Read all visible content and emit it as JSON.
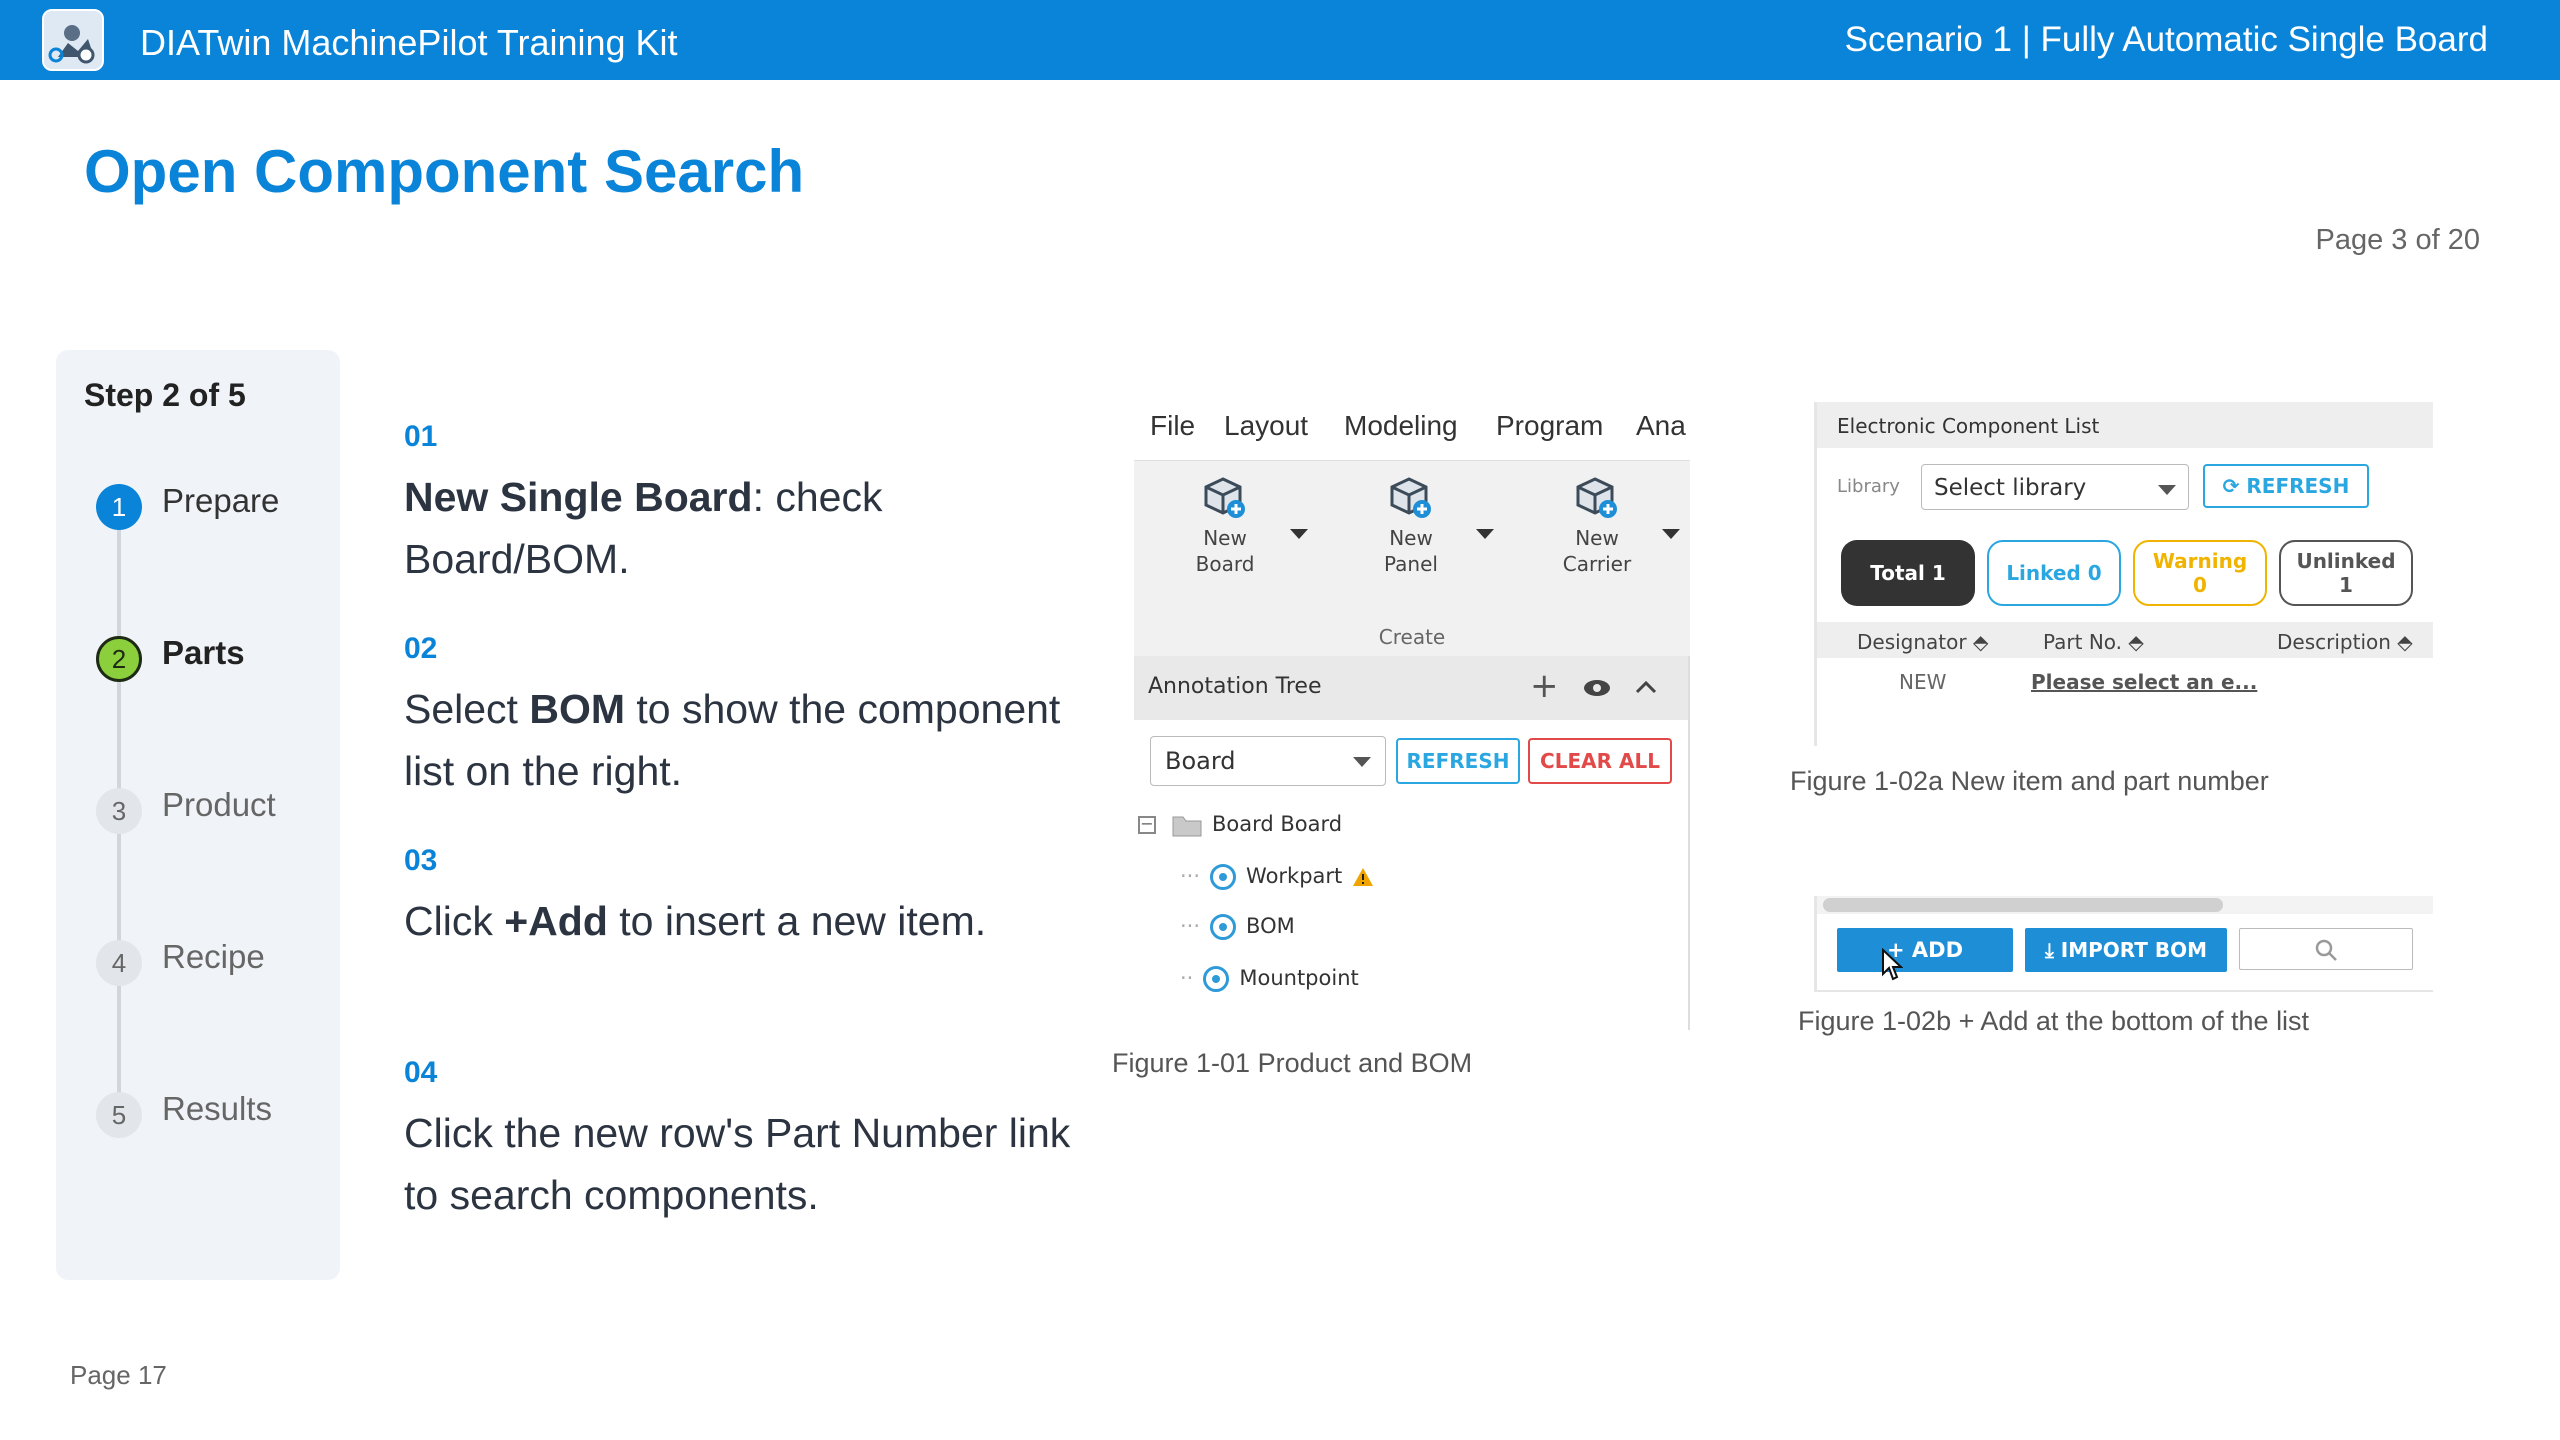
{
  "header": {
    "app_title": "DIATwin MachinePilot Training Kit",
    "scenario": "Scenario 1 | Fully Automatic Single Board",
    "accent_color": "#0a84d8"
  },
  "page": {
    "title": "Open Component Search",
    "page_of": "Page 3 of 20",
    "footer_page": "Page 17"
  },
  "steps": {
    "heading": "Step 2 of 5",
    "items": [
      {
        "num": "1",
        "label": "Prepare",
        "state": "done"
      },
      {
        "num": "2",
        "label": "Parts",
        "state": "current"
      },
      {
        "num": "3",
        "label": "Product",
        "state": "pending"
      },
      {
        "num": "4",
        "label": "Recipe",
        "state": "pending"
      },
      {
        "num": "5",
        "label": "Results",
        "state": "pending"
      }
    ]
  },
  "instructions": [
    {
      "num": "01",
      "bold": "New Single Board",
      "rest": ": check Board/BOM."
    },
    {
      "num": "02",
      "pre": "Select ",
      "bold": "BOM",
      "rest": " to show the component list on the right."
    },
    {
      "num": "03",
      "pre": "Click ",
      "bold": "+Add",
      "rest": " to insert a new item."
    },
    {
      "num": "04",
      "text": "Click the new row's Part Number link to search components."
    }
  ],
  "fig1": {
    "menu": [
      "File",
      "Layout",
      "Modeling",
      "Program",
      "Ana"
    ],
    "ribbon_buttons": [
      {
        "line1": "New",
        "line2": "Board",
        "icon": "cube-add-icon"
      },
      {
        "line1": "New",
        "line2": "Panel",
        "icon": "cube-add-icon"
      },
      {
        "line1": "New",
        "line2": "Carrier",
        "icon": "cube-add-icon"
      }
    ],
    "ribbon_group": "Create",
    "annotation_tree_title": "Annotation Tree",
    "select_value": "Board",
    "refresh_label": "REFRESH",
    "clear_all_label": "CLEAR ALL",
    "tree_root": "Board  Board",
    "tree_items": [
      "Workpart",
      "BOM",
      "Mountpoint"
    ],
    "caption": "Figure 1-01  Product and BOM"
  },
  "fig2a": {
    "title": "Electronic Component List",
    "library_label": "Library",
    "library_select": "Select library",
    "refresh_label": "REFRESH",
    "pills": [
      {
        "line1": "Total 1",
        "line2": ""
      },
      {
        "line1": "Linked 0",
        "line2": ""
      },
      {
        "line1": "Warning",
        "line2": "0"
      },
      {
        "line1": "Unlinked",
        "line2": "1"
      }
    ],
    "columns": [
      "Designator",
      "Part No.",
      "Description"
    ],
    "row": {
      "designator": "NEW",
      "part_no": "Please select an e..."
    },
    "caption": "Figure 1-02a  New item and part number"
  },
  "fig2b": {
    "add_label": "ADD",
    "import_label": "IMPORT BOM",
    "caption": "Figure 1-02b  + Add at the bottom of the list"
  }
}
